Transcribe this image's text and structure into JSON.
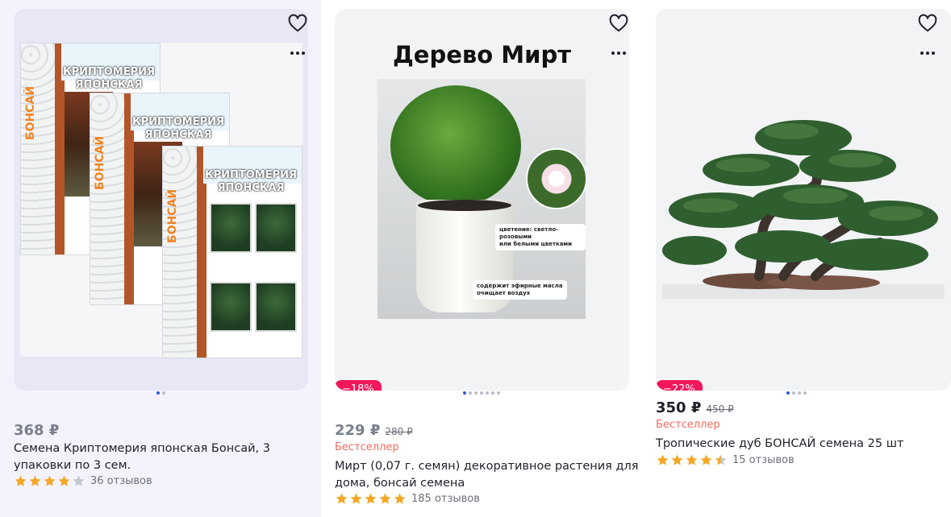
{
  "products": [
    {
      "price": "368 ₽",
      "old_price": "",
      "badge": "",
      "bestseller": "",
      "title_line1": "Семена Криптомерия японская Бонсай, 3",
      "title_line2": "упаковки по 3 сем.",
      "rating": 4,
      "reviews": "36 отзывов",
      "image": {
        "pack_brand": "БОНСАЙ",
        "pack_name_line1": "КРИПТОМЕРИЯ",
        "pack_name_line2": "ЯПОНСКАЯ"
      },
      "dots_total": 2,
      "dots_active": 0
    },
    {
      "price": "229 ₽",
      "old_price": "280 ₽",
      "badge": "−18%",
      "bestseller": "Бестселлер",
      "title_line1": "Мирт (0,07 г. семян) декоративное растения для",
      "title_line2": "дома, бонсай семена",
      "rating": 5,
      "reviews": "185 отзывов",
      "image": {
        "heading": "Дерево Мирт",
        "note1_line1": "цветение: светло-розовыми",
        "note1_line2": "или белыми цветками",
        "note2_line1": "содержит эфирные масла",
        "note2_line2": "очищает воздух"
      },
      "dots_total": 7,
      "dots_active": 0
    },
    {
      "price": "350 ₽",
      "old_price": "450 ₽",
      "badge": "−22%",
      "bestseller": "Бестселлер",
      "title_line1": "Тропические дуб БОНСАЙ семена 25 шт",
      "title_line2": "",
      "rating": 4.5,
      "reviews": "15 отзывов",
      "dots_total": 4,
      "dots_active": 0
    }
  ],
  "colors": {
    "accent_badge": "#f0185a",
    "star": "#f5a623",
    "star_empty": "#c4c7cf",
    "bestseller": "#f06b5e",
    "dot_active": "#2e5bd6"
  },
  "icons": [
    "heart-icon",
    "more-icon",
    "star-icon"
  ]
}
